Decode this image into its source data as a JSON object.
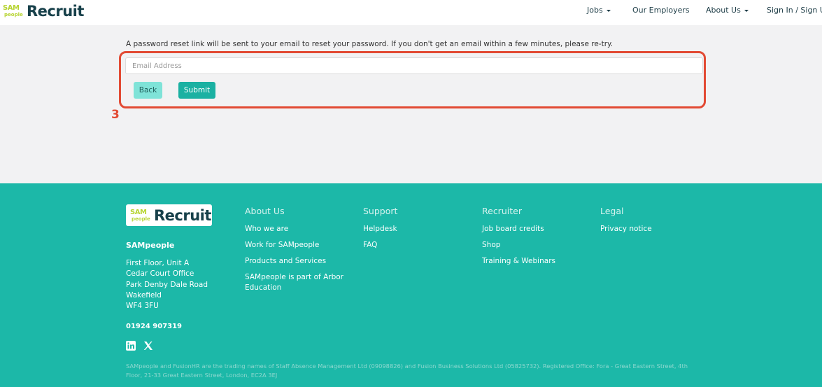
{
  "header": {
    "logo": {
      "mark_top": "SAM",
      "mark_bottom": "people",
      "word": "Recruit"
    },
    "nav": {
      "jobs": "Jobs",
      "employers": "Our Employers",
      "about": "About Us",
      "sign_in": "Sign In / Sign Up"
    }
  },
  "main": {
    "info_text": "A password reset link will be sent to your email to reset your password. If you don't get an email within a few minutes, please re-try.",
    "email_placeholder": "Email Address",
    "email_value": "",
    "back_label": "Back",
    "submit_label": "Submit",
    "annotation_number": "3"
  },
  "footer": {
    "logo": {
      "mark_top": "SAM",
      "mark_bottom": "people",
      "word": "Recruit"
    },
    "org_name": "SAMpeople",
    "address": [
      "First Floor, Unit A",
      "Cedar Court Office",
      "Park Denby Dale Road",
      "Wakefield",
      "WF4 3FU"
    ],
    "phone": "01924 907319",
    "social": [
      "linkedin-icon",
      "x-icon"
    ],
    "columns": [
      {
        "title": "About Us",
        "links": [
          "Who we are",
          "Work for SAMpeople",
          "Products and Services",
          "SAMpeople is part of Arbor Education"
        ]
      },
      {
        "title": "Support",
        "links": [
          "Helpdesk",
          "FAQ"
        ]
      },
      {
        "title": "Recruiter",
        "links": [
          "Job board credits",
          "Shop",
          "Training & Webinars"
        ]
      },
      {
        "title": "Legal",
        "links": [
          "Privacy notice"
        ]
      }
    ],
    "legal_text": "SAMpeople and FusionHR are the trading names of Staff Absence Management Ltd (09098826) and Fusion Business Solutions Ltd (05825732). Registered Office: Fora - Great Eastern Street, 4th Floor, 21-33 Great Eastern Street, London, EC2A 3EJ"
  },
  "colors": {
    "accent": "#1cb8a8",
    "annotation": "#e24a33",
    "brand_green": "#b7d433",
    "brand_dark": "#17404a"
  }
}
